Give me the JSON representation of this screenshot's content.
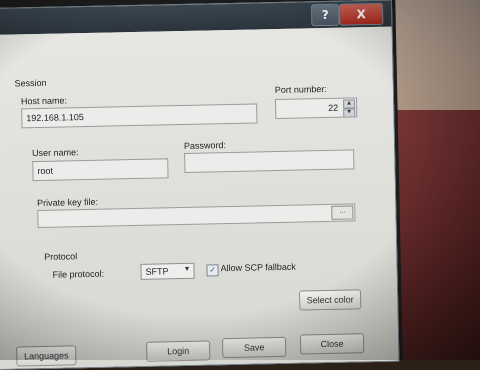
{
  "titlebar": {
    "help_label": "?",
    "close_label": "X"
  },
  "session": {
    "group_label": "Session",
    "host_label": "Host name:",
    "host_value": "192.168.1.105",
    "port_label": "Port number:",
    "port_value": "22",
    "user_label": "User name:",
    "user_value": "root",
    "password_label": "Password:",
    "password_value": "",
    "keyfile_label": "Private key file:",
    "keyfile_value": "",
    "browse_label": "..."
  },
  "protocol": {
    "group_label": "Protocol",
    "file_protocol_label": "File protocol:",
    "file_protocol_value": "SFTP",
    "scp_fallback_label": "Allow SCP fallback",
    "scp_fallback_checked": true
  },
  "buttons": {
    "select_color": "Select color",
    "languages": "Languages",
    "login": "Login",
    "save": "Save",
    "close": "Close"
  },
  "colors": {
    "titlebar": "#2b343c",
    "close_button": "#c0392b",
    "dialog_bg": "#dcdcd8"
  },
  "icons": {
    "spin_up": "chevron-up-icon",
    "spin_down": "chevron-down-icon",
    "dropdown": "chevron-down-icon",
    "check": "check-icon"
  }
}
